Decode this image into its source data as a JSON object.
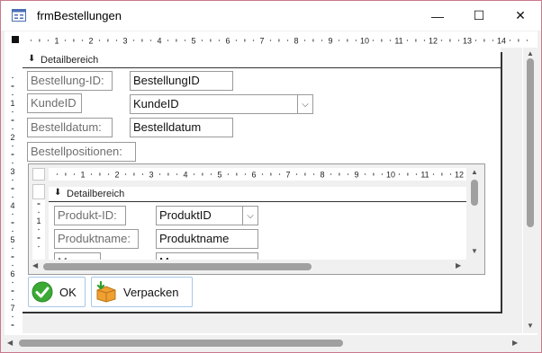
{
  "window": {
    "title": "frmBestellungen",
    "minimize": "—",
    "maximize": "☐",
    "close": "✕"
  },
  "rulers": {
    "main_numbers": [
      "1",
      "2",
      "3",
      "4",
      "5",
      "6",
      "7",
      "8",
      "9",
      "10",
      "11",
      "12",
      "13",
      "14"
    ],
    "main_v_numbers": [
      "1",
      "2",
      "3",
      "4",
      "5",
      "6",
      "7"
    ],
    "sub_numbers": [
      "1",
      "2",
      "3",
      "4",
      "5",
      "6",
      "7",
      "8",
      "9",
      "10",
      "11",
      "12"
    ],
    "sub_v_numbers": [
      "1"
    ]
  },
  "section": {
    "label": "Detailbereich"
  },
  "controls": {
    "bestellung_id_label": "Bestellung-ID:",
    "bestellung_id_field": "BestellungID",
    "kunde_id_label": "KundeID",
    "kunde_id_field": "KundeID",
    "bestelldatum_label": "Bestelldatum:",
    "bestelldatum_field": "Bestelldatum",
    "bestellpositionen_label": "Bestellpositionen:"
  },
  "subform": {
    "section_label": "Detailbereich",
    "produkt_id_label": "Produkt-ID:",
    "produkt_id_field": "ProduktID",
    "produktname_label": "Produktname:",
    "produktname_field": "Produktname",
    "menge_label": "Menge:",
    "menge_field": "Menge"
  },
  "buttons": {
    "ok": "OK",
    "verpacken": "Verpacken"
  },
  "colors": {
    "ok_green": "#3aaa35",
    "box_orange": "#f0a030",
    "arrow_green": "#2e9e2e"
  }
}
